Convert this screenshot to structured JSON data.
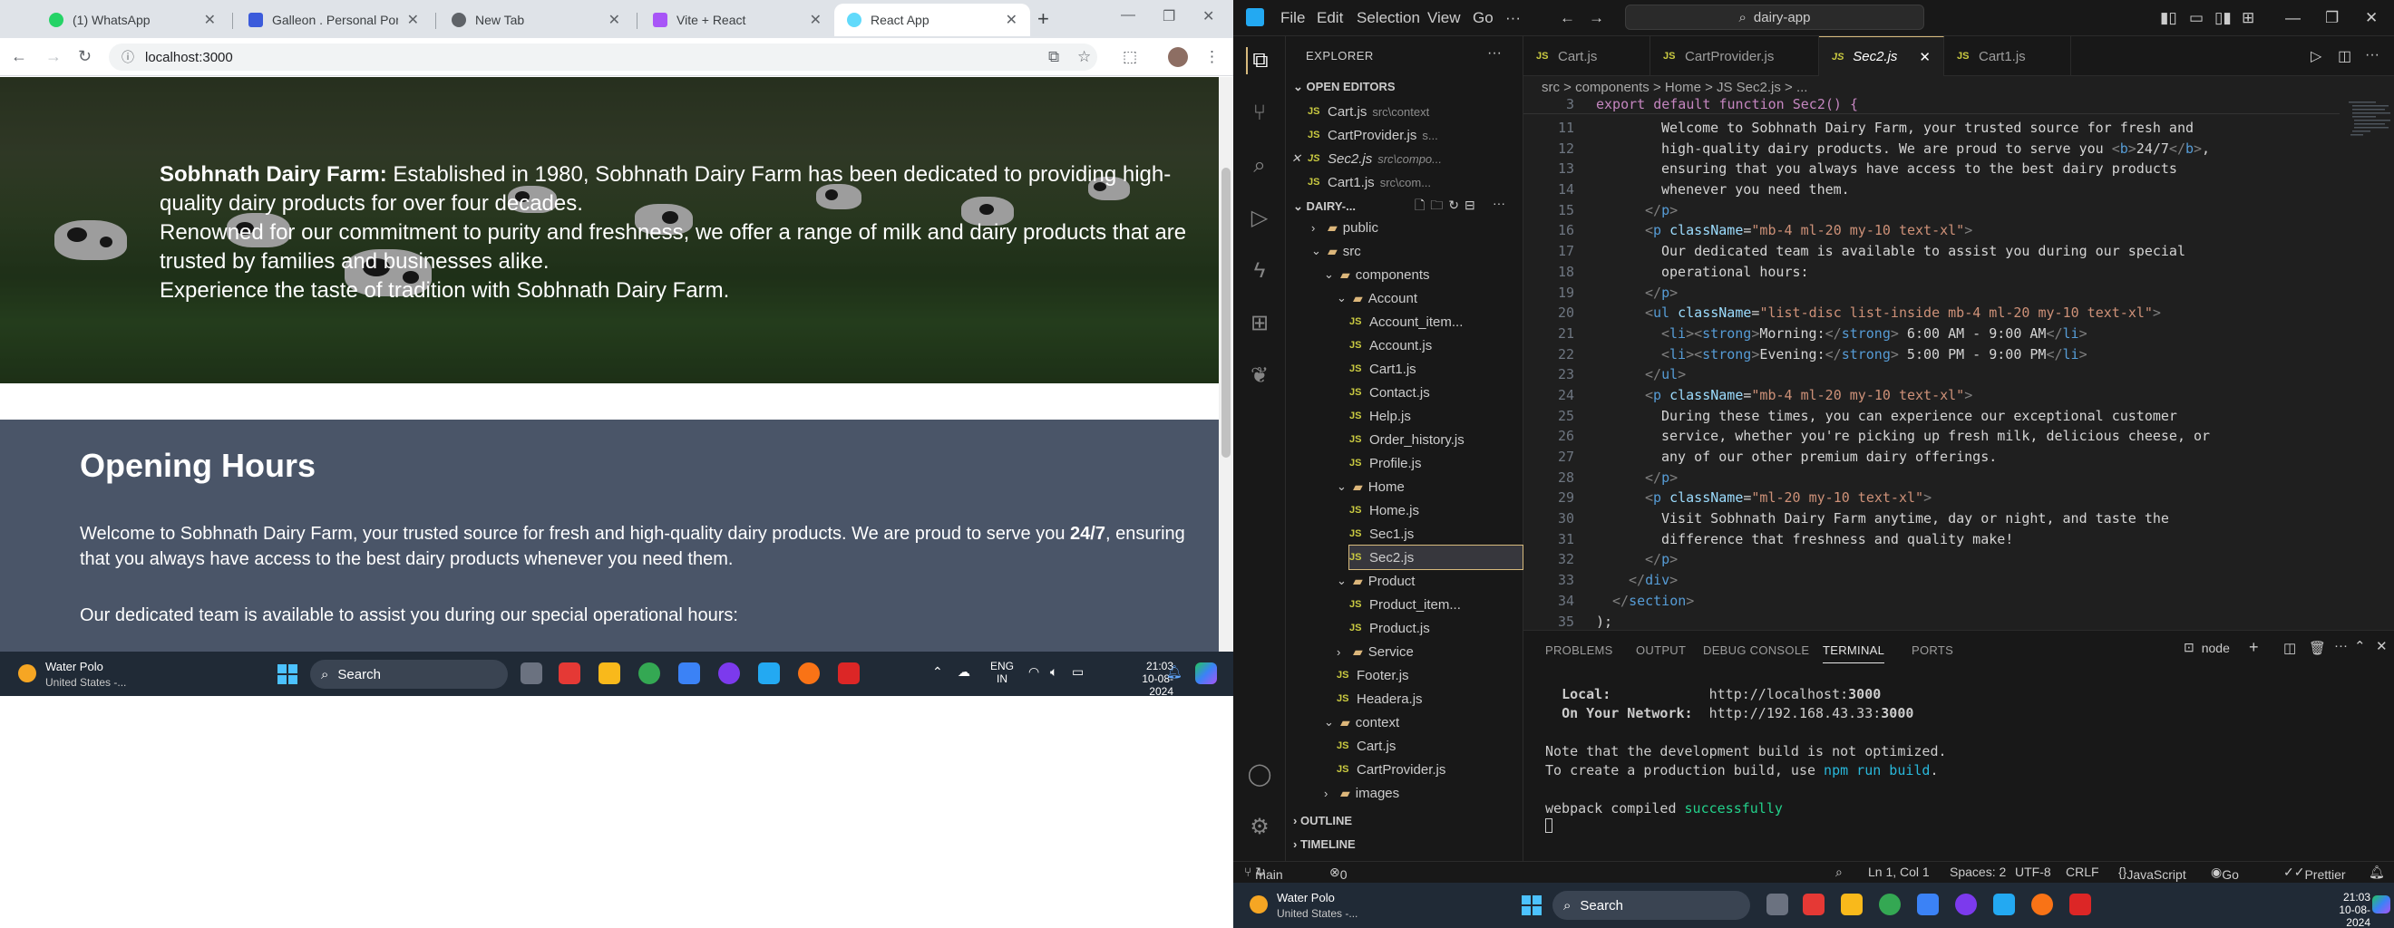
{
  "browser": {
    "tabs": [
      {
        "label": "(1) WhatsApp",
        "color": "#25d366"
      },
      {
        "label": "Galleon . Personal Portfolio",
        "color": "#3b5bdb"
      },
      {
        "label": "New Tab",
        "color": "#5f6368"
      },
      {
        "label": "Vite + React",
        "color": "#a855f7"
      },
      {
        "label": "React App",
        "color": "#61dafb"
      }
    ],
    "url": "localhost:3000",
    "page": {
      "hero_bold": "Sobhnath Dairy Farm:",
      "hero_line1": " Established in 1980, Sobhnath Dairy Farm has been dedicated to providing high-quality dairy products for over four decades.",
      "hero_line2": "Renowned for our commitment to purity and freshness, we offer a range of milk and dairy products that are trusted by families and businesses alike.",
      "hero_line3": "Experience the taste of tradition with Sobhnath Dairy Farm.",
      "hours_title": "Opening Hours",
      "hours_p1_a": "Welcome to Sobhnath Dairy Farm, your trusted source for fresh and high-quality dairy products. We are proud to serve you ",
      "hours_p1_b": "24/7",
      "hours_p1_c": ", ensuring that you always have access to the best dairy products whenever you need them.",
      "hours_p2": "Our dedicated team is available to assist you during our special operational hours:"
    },
    "taskbar": {
      "weather_title": "Water Polo",
      "weather_sub": "United States -...",
      "search": "Search",
      "lang1": "ENG",
      "lang2": "IN",
      "time": "21:03",
      "date": "10-08-2024"
    }
  },
  "vscode": {
    "menu": [
      "File",
      "Edit",
      "Selection",
      "View",
      "Go"
    ],
    "search": "dairy-app",
    "explorer_title": "EXPLORER",
    "open_editors_title": "OPEN EDITORS",
    "open_editors": [
      {
        "name": "Cart.js",
        "path": "src\\context"
      },
      {
        "name": "CartProvider.js",
        "path": "s..."
      },
      {
        "name": "Sec2.js",
        "path": "src\\compo..."
      },
      {
        "name": "Cart1.js",
        "path": "src\\com..."
      }
    ],
    "project_title": "DAIRY-...",
    "tree": [
      {
        "name": "public",
        "type": "folder"
      },
      {
        "name": "src",
        "type": "folder"
      },
      {
        "name": "components",
        "type": "folder"
      },
      {
        "name": "Account",
        "type": "folder"
      },
      {
        "name": "Account_item...",
        "type": "js"
      },
      {
        "name": "Account.js",
        "type": "js"
      },
      {
        "name": "Cart1.js",
        "type": "js"
      },
      {
        "name": "Contact.js",
        "type": "js"
      },
      {
        "name": "Help.js",
        "type": "js"
      },
      {
        "name": "Order_history.js",
        "type": "js"
      },
      {
        "name": "Profile.js",
        "type": "js"
      },
      {
        "name": "Home",
        "type": "folder"
      },
      {
        "name": "Home.js",
        "type": "js"
      },
      {
        "name": "Sec1.js",
        "type": "js"
      },
      {
        "name": "Sec2.js",
        "type": "js"
      },
      {
        "name": "Product",
        "type": "folder"
      },
      {
        "name": "Product_item...",
        "type": "js"
      },
      {
        "name": "Product.js",
        "type": "js"
      },
      {
        "name": "Service",
        "type": "folder"
      },
      {
        "name": "Footer.js",
        "type": "js"
      },
      {
        "name": "Headera.js",
        "type": "js"
      },
      {
        "name": "context",
        "type": "folder"
      },
      {
        "name": "Cart.js",
        "type": "js"
      },
      {
        "name": "CartProvider.js",
        "type": "js"
      },
      {
        "name": "images",
        "type": "folder"
      }
    ],
    "outline": "OUTLINE",
    "timeline": "TIMELINE",
    "editor_tabs": [
      "Cart.js",
      "CartProvider.js",
      "Sec2.js",
      "Cart1.js"
    ],
    "breadcrumb": "src > components > Home > JS Sec2.js > ...",
    "sticky_line_no": "3",
    "sticky_line": "export default function Sec2() {",
    "code_lines": [
      {
        "n": "11",
        "t": "Welcome to Sobhnath Dairy Farm, your trusted source for fresh and"
      },
      {
        "n": "12",
        "t": "high-quality dairy products. We are proud to serve you <b>24/7</b>,"
      },
      {
        "n": "13",
        "t": "ensuring that you always have access to the best dairy products"
      },
      {
        "n": "14",
        "t": "whenever you need them."
      },
      {
        "n": "15",
        "t": "</p>"
      },
      {
        "n": "16",
        "t": "<p className=\"mb-4 ml-20 my-10 text-xl\">"
      },
      {
        "n": "17",
        "t": "Our dedicated team is available to assist you during our special"
      },
      {
        "n": "18",
        "t": "operational hours:"
      },
      {
        "n": "19",
        "t": "</p>"
      },
      {
        "n": "20",
        "t": "<ul className=\"list-disc list-inside mb-4 ml-20 my-10 text-xl\">"
      },
      {
        "n": "21",
        "t": "<li><strong>Morning:</strong> 6:00 AM - 9:00 AM</li>"
      },
      {
        "n": "22",
        "t": "<li><strong>Evening:</strong> 5:00 PM - 9:00 PM</li>"
      },
      {
        "n": "23",
        "t": "</ul>"
      },
      {
        "n": "24",
        "t": "<p className=\"mb-4 ml-20 my-10 text-xl\">"
      },
      {
        "n": "25",
        "t": "During these times, you can experience our exceptional customer"
      },
      {
        "n": "26",
        "t": "service, whether you're picking up fresh milk, delicious cheese, or"
      },
      {
        "n": "27",
        "t": "any of our other premium dairy offerings."
      },
      {
        "n": "28",
        "t": "</p>"
      },
      {
        "n": "29",
        "t": "<p className=\"ml-20 my-10 text-xl\">"
      },
      {
        "n": "30",
        "t": "Visit Sobhnath Dairy Farm anytime, day or night, and taste the"
      },
      {
        "n": "31",
        "t": "difference that freshness and quality make!"
      },
      {
        "n": "32",
        "t": "</p>"
      },
      {
        "n": "33",
        "t": "</div>"
      },
      {
        "n": "34",
        "t": "</section>"
      },
      {
        "n": "35",
        "t": ");"
      }
    ],
    "panel_tabs": [
      "PROBLEMS",
      "OUTPUT",
      "DEBUG CONSOLE",
      "TERMINAL",
      "PORTS"
    ],
    "terminal_shell": "node",
    "terminal": {
      "local_label": "Local:",
      "local_url": "http://localhost:",
      "local_port": "3000",
      "net_label": "On Your Network:",
      "net_url": "http://192.168.43.33:",
      "net_port": "3000",
      "note1": "Note that the development build is not optimized.",
      "note2a": "To create a production build, use ",
      "note2b": "npm run build",
      "note2c": ".",
      "compiled_a": "webpack compiled ",
      "compiled_b": "successfully"
    },
    "status": {
      "branch": "main",
      "errors": "0",
      "pos": "Ln 1, Col 1",
      "spaces": "Spaces: 2",
      "enc": "UTF-8",
      "eol": "CRLF",
      "lang": "JavaScript",
      "golive": "Go Live",
      "prettier": "Prettier"
    },
    "taskbar": {
      "weather_title": "Water Polo",
      "weather_sub": "United States -...",
      "search": "Search",
      "time": "21:03",
      "date": "10-08-2024"
    }
  },
  "colors": {
    "accent": "#d7ba7d",
    "success": "#23d18b",
    "link": "#29b8db"
  }
}
